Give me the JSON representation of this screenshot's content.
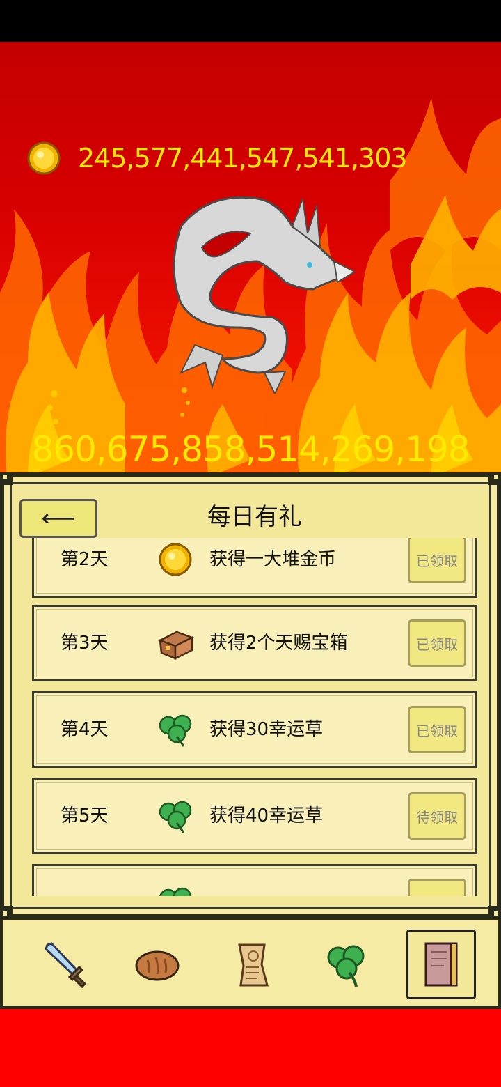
{
  "coins": {
    "value": "245,577,441,547,541,303",
    "icon": "gold-coin-icon"
  },
  "boss": {
    "name_icon": "silver-dragon",
    "hp_value": "860,675,858,514,269,198"
  },
  "daily_gift": {
    "title": "每日有礼",
    "back_label": "⟵",
    "items": [
      {
        "day": "第2天",
        "icon": "gold-coin-icon",
        "reward": "获得一大堆金币",
        "status": "已领取"
      },
      {
        "day": "第3天",
        "icon": "treasure-chest-icon",
        "reward": "获得2个天赐宝箱",
        "status": "已领取"
      },
      {
        "day": "第4天",
        "icon": "clover-icon",
        "reward": "获得30幸运草",
        "status": "已领取"
      },
      {
        "day": "第5天",
        "icon": "clover-icon",
        "reward": "获得40幸运草",
        "status": "待领取"
      }
    ]
  },
  "tabs": [
    {
      "icon": "sword-icon"
    },
    {
      "icon": "bread-icon"
    },
    {
      "icon": "scroll-icon"
    },
    {
      "icon": "clover-icon"
    },
    {
      "icon": "book-icon",
      "selected": true
    }
  ],
  "colors": {
    "accent_yellow": "#ffea00",
    "panel_bg": "#f6eba4",
    "background_red": "#ff0000"
  }
}
